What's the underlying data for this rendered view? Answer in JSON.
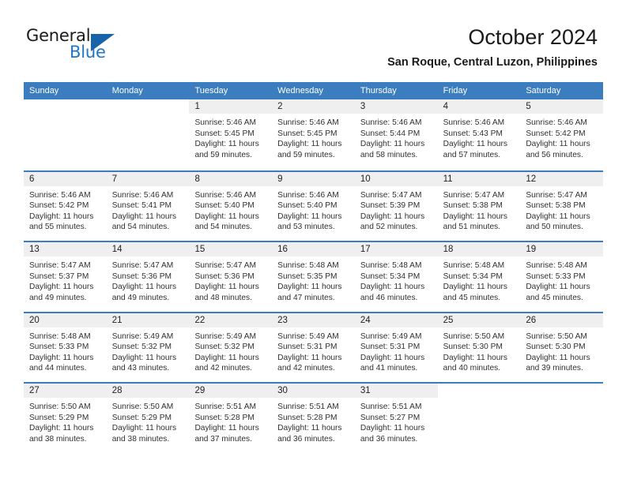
{
  "brand": {
    "name_part1": "General",
    "name_part2": "Blue",
    "logo_icon": "triangle-icon"
  },
  "header": {
    "month_title": "October 2024",
    "location": "San Roque, Central Luzon, Philippines"
  },
  "colors": {
    "header_blue": "#3b7dbf",
    "brand_blue": "#1f76c2",
    "daynum_band": "#efefef",
    "text": "#303030"
  },
  "weekdays": [
    "Sunday",
    "Monday",
    "Tuesday",
    "Wednesday",
    "Thursday",
    "Friday",
    "Saturday"
  ],
  "weeks": [
    [
      {
        "empty": true
      },
      {
        "empty": true
      },
      {
        "day": "1",
        "sunrise": "Sunrise: 5:46 AM",
        "sunset": "Sunset: 5:45 PM",
        "daylight1": "Daylight: 11 hours",
        "daylight2": "and 59 minutes."
      },
      {
        "day": "2",
        "sunrise": "Sunrise: 5:46 AM",
        "sunset": "Sunset: 5:45 PM",
        "daylight1": "Daylight: 11 hours",
        "daylight2": "and 59 minutes."
      },
      {
        "day": "3",
        "sunrise": "Sunrise: 5:46 AM",
        "sunset": "Sunset: 5:44 PM",
        "daylight1": "Daylight: 11 hours",
        "daylight2": "and 58 minutes."
      },
      {
        "day": "4",
        "sunrise": "Sunrise: 5:46 AM",
        "sunset": "Sunset: 5:43 PM",
        "daylight1": "Daylight: 11 hours",
        "daylight2": "and 57 minutes."
      },
      {
        "day": "5",
        "sunrise": "Sunrise: 5:46 AM",
        "sunset": "Sunset: 5:42 PM",
        "daylight1": "Daylight: 11 hours",
        "daylight2": "and 56 minutes."
      }
    ],
    [
      {
        "day": "6",
        "sunrise": "Sunrise: 5:46 AM",
        "sunset": "Sunset: 5:42 PM",
        "daylight1": "Daylight: 11 hours",
        "daylight2": "and 55 minutes."
      },
      {
        "day": "7",
        "sunrise": "Sunrise: 5:46 AM",
        "sunset": "Sunset: 5:41 PM",
        "daylight1": "Daylight: 11 hours",
        "daylight2": "and 54 minutes."
      },
      {
        "day": "8",
        "sunrise": "Sunrise: 5:46 AM",
        "sunset": "Sunset: 5:40 PM",
        "daylight1": "Daylight: 11 hours",
        "daylight2": "and 54 minutes."
      },
      {
        "day": "9",
        "sunrise": "Sunrise: 5:46 AM",
        "sunset": "Sunset: 5:40 PM",
        "daylight1": "Daylight: 11 hours",
        "daylight2": "and 53 minutes."
      },
      {
        "day": "10",
        "sunrise": "Sunrise: 5:47 AM",
        "sunset": "Sunset: 5:39 PM",
        "daylight1": "Daylight: 11 hours",
        "daylight2": "and 52 minutes."
      },
      {
        "day": "11",
        "sunrise": "Sunrise: 5:47 AM",
        "sunset": "Sunset: 5:38 PM",
        "daylight1": "Daylight: 11 hours",
        "daylight2": "and 51 minutes."
      },
      {
        "day": "12",
        "sunrise": "Sunrise: 5:47 AM",
        "sunset": "Sunset: 5:38 PM",
        "daylight1": "Daylight: 11 hours",
        "daylight2": "and 50 minutes."
      }
    ],
    [
      {
        "day": "13",
        "sunrise": "Sunrise: 5:47 AM",
        "sunset": "Sunset: 5:37 PM",
        "daylight1": "Daylight: 11 hours",
        "daylight2": "and 49 minutes."
      },
      {
        "day": "14",
        "sunrise": "Sunrise: 5:47 AM",
        "sunset": "Sunset: 5:36 PM",
        "daylight1": "Daylight: 11 hours",
        "daylight2": "and 49 minutes."
      },
      {
        "day": "15",
        "sunrise": "Sunrise: 5:47 AM",
        "sunset": "Sunset: 5:36 PM",
        "daylight1": "Daylight: 11 hours",
        "daylight2": "and 48 minutes."
      },
      {
        "day": "16",
        "sunrise": "Sunrise: 5:48 AM",
        "sunset": "Sunset: 5:35 PM",
        "daylight1": "Daylight: 11 hours",
        "daylight2": "and 47 minutes."
      },
      {
        "day": "17",
        "sunrise": "Sunrise: 5:48 AM",
        "sunset": "Sunset: 5:34 PM",
        "daylight1": "Daylight: 11 hours",
        "daylight2": "and 46 minutes."
      },
      {
        "day": "18",
        "sunrise": "Sunrise: 5:48 AM",
        "sunset": "Sunset: 5:34 PM",
        "daylight1": "Daylight: 11 hours",
        "daylight2": "and 45 minutes."
      },
      {
        "day": "19",
        "sunrise": "Sunrise: 5:48 AM",
        "sunset": "Sunset: 5:33 PM",
        "daylight1": "Daylight: 11 hours",
        "daylight2": "and 45 minutes."
      }
    ],
    [
      {
        "day": "20",
        "sunrise": "Sunrise: 5:48 AM",
        "sunset": "Sunset: 5:33 PM",
        "daylight1": "Daylight: 11 hours",
        "daylight2": "and 44 minutes."
      },
      {
        "day": "21",
        "sunrise": "Sunrise: 5:49 AM",
        "sunset": "Sunset: 5:32 PM",
        "daylight1": "Daylight: 11 hours",
        "daylight2": "and 43 minutes."
      },
      {
        "day": "22",
        "sunrise": "Sunrise: 5:49 AM",
        "sunset": "Sunset: 5:32 PM",
        "daylight1": "Daylight: 11 hours",
        "daylight2": "and 42 minutes."
      },
      {
        "day": "23",
        "sunrise": "Sunrise: 5:49 AM",
        "sunset": "Sunset: 5:31 PM",
        "daylight1": "Daylight: 11 hours",
        "daylight2": "and 42 minutes."
      },
      {
        "day": "24",
        "sunrise": "Sunrise: 5:49 AM",
        "sunset": "Sunset: 5:31 PM",
        "daylight1": "Daylight: 11 hours",
        "daylight2": "and 41 minutes."
      },
      {
        "day": "25",
        "sunrise": "Sunrise: 5:50 AM",
        "sunset": "Sunset: 5:30 PM",
        "daylight1": "Daylight: 11 hours",
        "daylight2": "and 40 minutes."
      },
      {
        "day": "26",
        "sunrise": "Sunrise: 5:50 AM",
        "sunset": "Sunset: 5:30 PM",
        "daylight1": "Daylight: 11 hours",
        "daylight2": "and 39 minutes."
      }
    ],
    [
      {
        "day": "27",
        "sunrise": "Sunrise: 5:50 AM",
        "sunset": "Sunset: 5:29 PM",
        "daylight1": "Daylight: 11 hours",
        "daylight2": "and 38 minutes."
      },
      {
        "day": "28",
        "sunrise": "Sunrise: 5:50 AM",
        "sunset": "Sunset: 5:29 PM",
        "daylight1": "Daylight: 11 hours",
        "daylight2": "and 38 minutes."
      },
      {
        "day": "29",
        "sunrise": "Sunrise: 5:51 AM",
        "sunset": "Sunset: 5:28 PM",
        "daylight1": "Daylight: 11 hours",
        "daylight2": "and 37 minutes."
      },
      {
        "day": "30",
        "sunrise": "Sunrise: 5:51 AM",
        "sunset": "Sunset: 5:28 PM",
        "daylight1": "Daylight: 11 hours",
        "daylight2": "and 36 minutes."
      },
      {
        "day": "31",
        "sunrise": "Sunrise: 5:51 AM",
        "sunset": "Sunset: 5:27 PM",
        "daylight1": "Daylight: 11 hours",
        "daylight2": "and 36 minutes."
      },
      {
        "empty": true
      },
      {
        "empty": true
      }
    ]
  ]
}
